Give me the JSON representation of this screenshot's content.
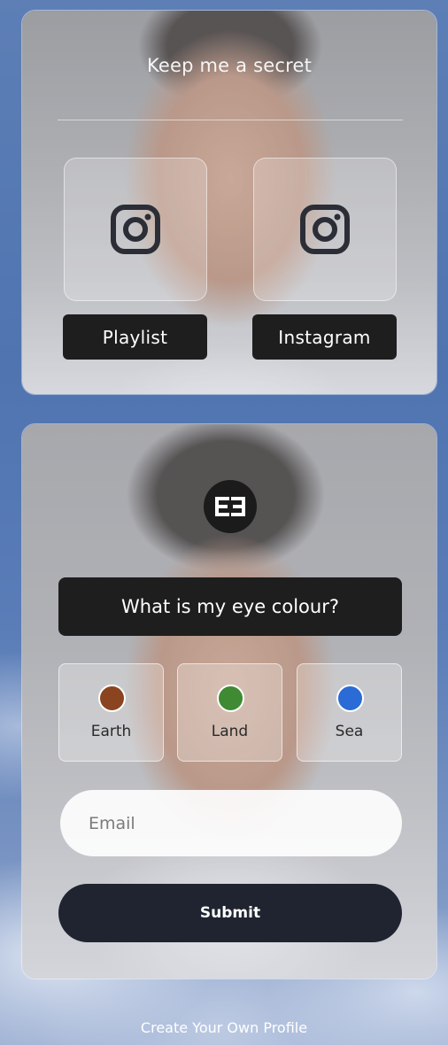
{
  "profile_card": {
    "title": "Keep me a secret",
    "tiles": [
      {
        "icon": "instagram-icon"
      },
      {
        "icon": "instagram-icon"
      }
    ],
    "buttons": [
      {
        "label": "Playlist"
      },
      {
        "label": "Instagram"
      }
    ]
  },
  "quiz_card": {
    "logo_icon": "ee-logo",
    "question": "What is my eye colour?",
    "options": [
      {
        "label": "Earth",
        "color": "#8a4520"
      },
      {
        "label": "Land",
        "color": "#3f8a32"
      },
      {
        "label": "Sea",
        "color": "#2a6bd6"
      }
    ],
    "email_placeholder": "Email",
    "email_value": "",
    "submit_label": "Submit"
  },
  "footer": {
    "link_label": "Create Your Own Profile"
  },
  "colors": {
    "button_dark": "#1e1e1e",
    "submit_dark": "#1f2430",
    "sky_blue": "#5d7fb6"
  }
}
